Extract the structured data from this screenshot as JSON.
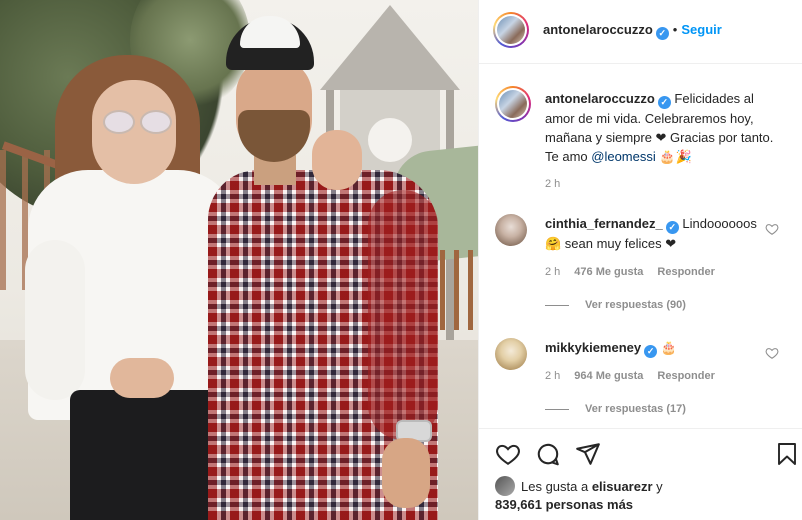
{
  "post": {
    "author": "antonelaroccuzzo",
    "follow_label": "Seguir",
    "separator": "•",
    "caption_text": "Felicidades al amor de mi vida. Celebraremos hoy, mañana y siempre ❤ Gracias por tanto. Te amo ",
    "caption_mention": "@leomessi",
    "caption_end": " 🎂🎉",
    "caption_time": "2 h"
  },
  "comments": [
    {
      "username": "cinthia_fernandez_",
      "text": "Lindoooooos 🤗 sean muy felices ❤",
      "time": "2 h",
      "likes": "476 Me gusta",
      "reply_label": "Responder",
      "view_replies": "Ver respuestas (90)"
    },
    {
      "username": "mikkykiemeney",
      "text": "🎂",
      "time": "2 h",
      "likes": "964 Me gusta",
      "reply_label": "Responder",
      "view_replies": "Ver respuestas (17)"
    }
  ],
  "likes": {
    "prefix": "Les gusta a ",
    "user": "elisuarezr",
    "middle": " y",
    "count": "839,661 personas más"
  },
  "icons": {
    "like": "heart-icon",
    "comment": "comment-icon",
    "share": "share-icon",
    "save": "bookmark-icon",
    "verified": "verified-badge-icon"
  },
  "colors": {
    "verified": "#3897f0",
    "follow": "#0095f6",
    "secondary_text": "#8e8e8e",
    "mention": "#00376b"
  }
}
